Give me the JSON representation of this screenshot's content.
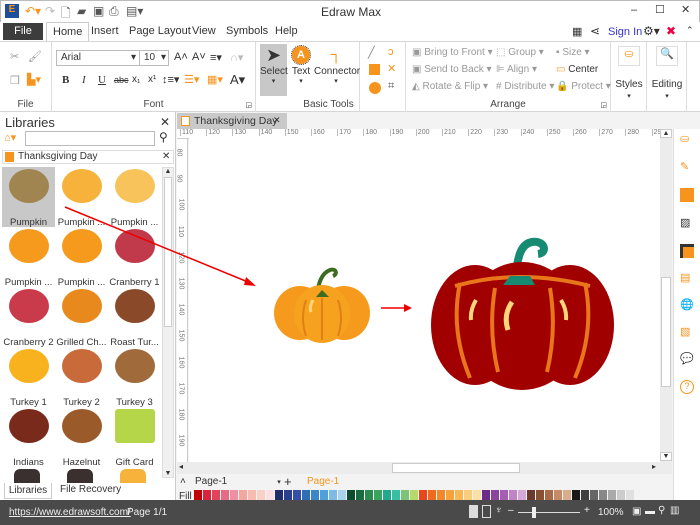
{
  "app": {
    "title": "Edraw Max"
  },
  "menu": {
    "file": "File",
    "tabs": [
      "Home",
      "Insert",
      "Page Layout",
      "View",
      "Symbols",
      "Help"
    ],
    "sign_in": "Sign In"
  },
  "ribbon": {
    "file_group": "File",
    "font_group": "Font",
    "font_name": "Arial",
    "font_size": "10",
    "basic_tools_group": "Basic Tools",
    "select": "Select",
    "text": "Text",
    "connector": "Connector",
    "arrange_group": "Arrange",
    "bring_to_front": "Bring to Front",
    "send_to_back": "Send to Back",
    "rotate_flip": "Rotate & Flip",
    "group": "Group",
    "align": "Align",
    "distribute": "Distribute",
    "size": "Size",
    "center": "Center",
    "protect": "Protect",
    "styles": "Styles",
    "editing": "Editing"
  },
  "libraries": {
    "title": "Libraries",
    "search_placeholder": "",
    "category": "Thanksgiving Day",
    "items": [
      "Pumpkin",
      "Pumpkin ...",
      "Pumpkin ...",
      "Pumpkin ...",
      "Pumpkin ...",
      "Cranberry 1",
      "Cranberry 2",
      "Grilled Ch...",
      "Roast Tur...",
      "Turkey 1",
      "Turkey 2",
      "Turkey 3",
      "Indians",
      "Hazelnut",
      "Gift Card"
    ],
    "tabs": [
      "Libraries",
      "File Recovery"
    ]
  },
  "document": {
    "tab": "Thanksgiving Day",
    "ruler_top": [
      "110",
      "120",
      "130",
      "140",
      "150",
      "160",
      "170",
      "180",
      "190",
      "200",
      "210",
      "220",
      "230",
      "240",
      "250",
      "260",
      "270",
      "280",
      "290"
    ],
    "ruler_left": [
      "80",
      "90",
      "100",
      "110",
      "120",
      "130",
      "140",
      "150",
      "160",
      "170",
      "180",
      "190"
    ]
  },
  "pages": {
    "current": "Page-1",
    "tab": "Page-1",
    "fill_label": "Fill"
  },
  "palette": [
    "#c00000",
    "#d9243b",
    "#e0435a",
    "#e66b84",
    "#ef8fa3",
    "#f4a6a0",
    "#f7bcb0",
    "#f9d0c8",
    "#fbe0e6",
    "#1f2d6b",
    "#2c3f8f",
    "#3450a8",
    "#2f6db5",
    "#3a86c8",
    "#4fa0da",
    "#7dbbe6",
    "#a9d2ef",
    "#0d4d2e",
    "#1a6b3f",
    "#2b8a4f",
    "#3aa35d",
    "#22a88c",
    "#38bfa3",
    "#7cc576",
    "#b5d96b",
    "#e8471c",
    "#ef6a1f",
    "#f3882a",
    "#f6a23a",
    "#f8b955",
    "#fbcd7a",
    "#fbe0a5",
    "#6a2b8a",
    "#8a449e",
    "#a45fb2",
    "#c084c6",
    "#d6a8d8",
    "#6b3a2a",
    "#8a5033",
    "#a86b48",
    "#c48b66",
    "#d8ad8c",
    "#1a1a1a",
    "#404040",
    "#666",
    "#888",
    "#aaa",
    "#ccc",
    "#e0e0e0"
  ],
  "status": {
    "url": "https://www.edrawsoft.com/",
    "page": "Page 1/1",
    "zoom": "100%"
  },
  "colors": {
    "accent": "#f7941d",
    "file_btn": "#3d3d3d",
    "status_bg": "#4a4a4a",
    "link": "#3333cc"
  }
}
